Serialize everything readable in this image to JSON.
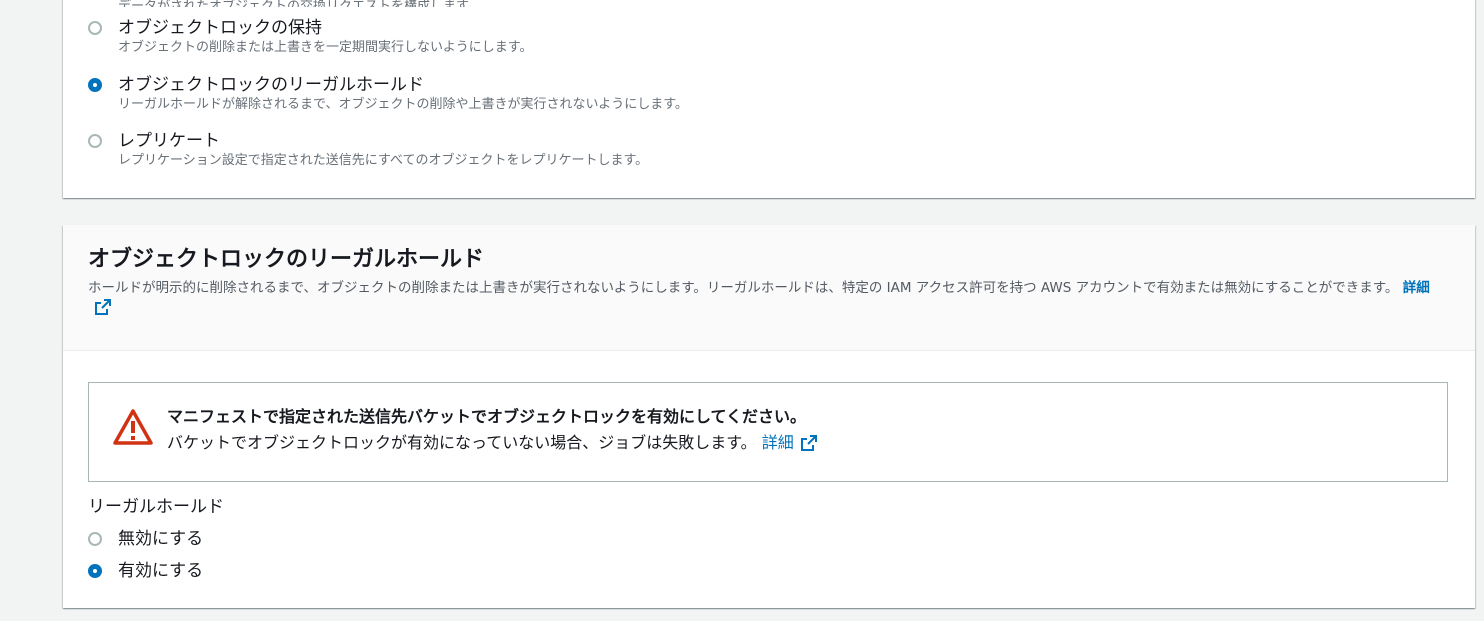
{
  "top_section": {
    "partial_text": "データがされたオブジェクトの交換リクエストを構成します。",
    "options": [
      {
        "label": "オブジェクトロックの保持",
        "description": "オブジェクトの削除または上書きを一定期間実行しないようにします。",
        "selected": false
      },
      {
        "label": "オブジェクトロックのリーガルホールド",
        "description": "リーガルホールドが解除されるまで、オブジェクトの削除や上書きが実行されないようにします。",
        "selected": true
      },
      {
        "label": "レプリケート",
        "description": "レプリケーション設定で指定された送信先にすべてのオブジェクトをレプリケートします。",
        "selected": false
      }
    ]
  },
  "legal_hold_section": {
    "title": "オブジェクトロックのリーガルホールド",
    "description": "ホールドが明示的に削除されるまで、オブジェクトの削除または上書きが実行されないようにします。リーガルホールドは、特定の IAM アクセス許可を持つ AWS アカウントで有効または無効にすることができます。",
    "learn_more": "詳細",
    "alert": {
      "title": "マニフェストで指定された送信先バケットでオブジェクトロックを有効にしてください。",
      "body": "バケットでオブジェクトロックが有効になっていない場合、ジョブは失敗します。",
      "learn_more": "詳細"
    },
    "field_label": "リーガルホールド",
    "options": [
      {
        "label": "無効にする",
        "selected": false
      },
      {
        "label": "有効にする",
        "selected": true
      }
    ]
  },
  "colors": {
    "accent": "#0073bb",
    "warning": "#d13212",
    "background": "#f2f3f3"
  }
}
